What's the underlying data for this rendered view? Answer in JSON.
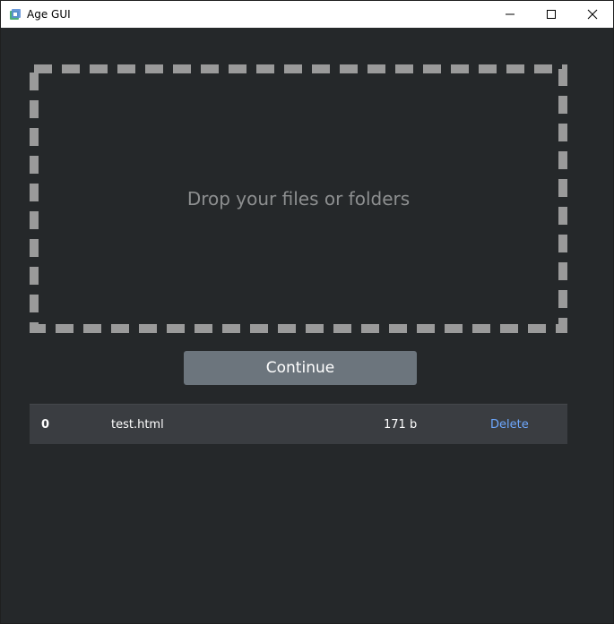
{
  "window": {
    "title": "Age GUI",
    "icon": "app-icon"
  },
  "dropzone": {
    "text": "Drop your files or folders"
  },
  "actions": {
    "continue_label": "Continue"
  },
  "files": [
    {
      "index": "0",
      "name": "test.html",
      "size": "171 b",
      "delete_label": "Delete"
    }
  ],
  "colors": {
    "background": "#25282a",
    "dashed_border": "#9a9a9a",
    "button": "#6c757d",
    "row": "#3a3d41",
    "link": "#6ea8fe"
  }
}
